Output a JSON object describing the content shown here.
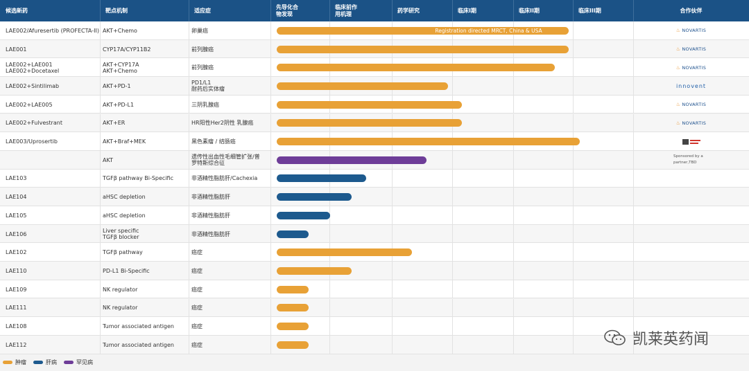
{
  "header": {
    "columns": [
      "候选新药",
      "靶点机制",
      "适应症",
      "先导化合\n物发现",
      "临床前作\n用机理",
      "药学研究",
      "临床I期",
      "临床II期",
      "临床III期",
      "合作伙伴"
    ]
  },
  "colors": {
    "oncology": "#e8a136",
    "liver": "#1d5a8e",
    "rare": "#6e3d98",
    "header": "#1b5286"
  },
  "rows": [
    {
      "drug": "LAE002/Afuresertib (PROFECTA-II)",
      "mechanism": "AKT+Chemo",
      "indication": "卵巢癌",
      "color": "oncology",
      "stage": 0.82,
      "bar_label": "Registration directed MRCT, China & USA",
      "partner": "NOVARTIS"
    },
    {
      "drug": "LAE001",
      "mechanism": "CYP17A/CYP11B2",
      "indication": "前列腺癌",
      "color": "oncology",
      "stage": 0.82,
      "bar_label": "",
      "partner": "NOVARTIS"
    },
    {
      "drug": "LAE002+LAE001\nLAE002+Docetaxel",
      "mechanism": "AKT+CYP17A\nAKT+Chemo",
      "indication": "前列腺癌",
      "color": "oncology",
      "stage": 0.78,
      "bar_label": "",
      "partner": "NOVARTIS"
    },
    {
      "drug": "LAE002+Sintilimab",
      "mechanism": "AKT+PD-1",
      "indication": "PD1/L1\n耐药后实体瘤",
      "color": "oncology",
      "stage": 0.48,
      "bar_label": "",
      "partner": "INNOVENT"
    },
    {
      "drug": "LAE002+LAE005",
      "mechanism": "AKT+PD-L1",
      "indication": "三阴乳腺癌",
      "color": "oncology",
      "stage": 0.52,
      "bar_label": "",
      "partner": "NOVARTIS"
    },
    {
      "drug": "LAE002+Fulvestrant",
      "mechanism": "AKT+ER",
      "indication": "HR阳性Her2阴性 乳腺癌",
      "color": "oncology",
      "stage": 0.52,
      "bar_label": "",
      "partner": "NOVARTIS"
    },
    {
      "drug": "LAE003/Uprosertib",
      "mechanism": "AKT+Braf+MEK",
      "indication": "黑色素瘤 / 结肠癌",
      "color": "oncology",
      "stage": 0.85,
      "bar_label": "",
      "partner": "SPONSOR_LOGO"
    },
    {
      "drug": "",
      "mechanism": "AKT",
      "indication": "遗传性出血性毛细管扩张/普\n罗特斯综合征",
      "color": "rare",
      "stage": 0.42,
      "bar_label": "",
      "partner": "Sponsored by a\npartner,TBD"
    },
    {
      "drug": "LAE103",
      "mechanism": "TGFβ pathway Bi-Specific",
      "indication": "非酒精性脂肪肝/Cachexia",
      "color": "liver",
      "stage": 0.25,
      "bar_label": "",
      "partner": ""
    },
    {
      "drug": "LAE104",
      "mechanism": "aHSC depletion",
      "indication": "非酒精性脂肪肝",
      "color": "liver",
      "stage": 0.21,
      "bar_label": "",
      "partner": ""
    },
    {
      "drug": "LAE105",
      "mechanism": "aHSC depletion",
      "indication": "非酒精性脂肪肝",
      "color": "liver",
      "stage": 0.15,
      "bar_label": "",
      "partner": ""
    },
    {
      "drug": "LAE106",
      "mechanism": "Liver specific\nTGFβ blocker",
      "indication": "非酒精性脂肪肝",
      "color": "liver",
      "stage": 0.09,
      "bar_label": "",
      "partner": ""
    },
    {
      "drug": "LAE102",
      "mechanism": "TGFβ pathway",
      "indication": "癌症",
      "color": "oncology",
      "stage": 0.38,
      "bar_label": "",
      "partner": ""
    },
    {
      "drug": "LAE110",
      "mechanism": "PD-L1 Bi-Specific",
      "indication": "癌症",
      "color": "oncology",
      "stage": 0.21,
      "bar_label": "",
      "partner": ""
    },
    {
      "drug": "LAE109",
      "mechanism": "NK regulator",
      "indication": "癌症",
      "color": "oncology",
      "stage": 0.09,
      "bar_label": "",
      "partner": ""
    },
    {
      "drug": "LAE111",
      "mechanism": "NK regulator",
      "indication": "癌症",
      "color": "oncology",
      "stage": 0.09,
      "bar_label": "",
      "partner": ""
    },
    {
      "drug": "LAE108",
      "mechanism": "Tumor associated antigen",
      "indication": "癌症",
      "color": "oncology",
      "stage": 0.09,
      "bar_label": "",
      "partner": ""
    },
    {
      "drug": "LAE112",
      "mechanism": "Tumor associated antigen",
      "indication": "癌症",
      "color": "oncology",
      "stage": 0.09,
      "bar_label": "",
      "partner": ""
    }
  ],
  "partner_labels": {
    "novartis": "NOVARTIS",
    "innovent": "innovent"
  },
  "legend": [
    {
      "label": "肿瘤",
      "color": "oncology"
    },
    {
      "label": "肝病",
      "color": "liver"
    },
    {
      "label": "罕见病",
      "color": "rare"
    }
  ],
  "watermark": "凯莱英药闻"
}
